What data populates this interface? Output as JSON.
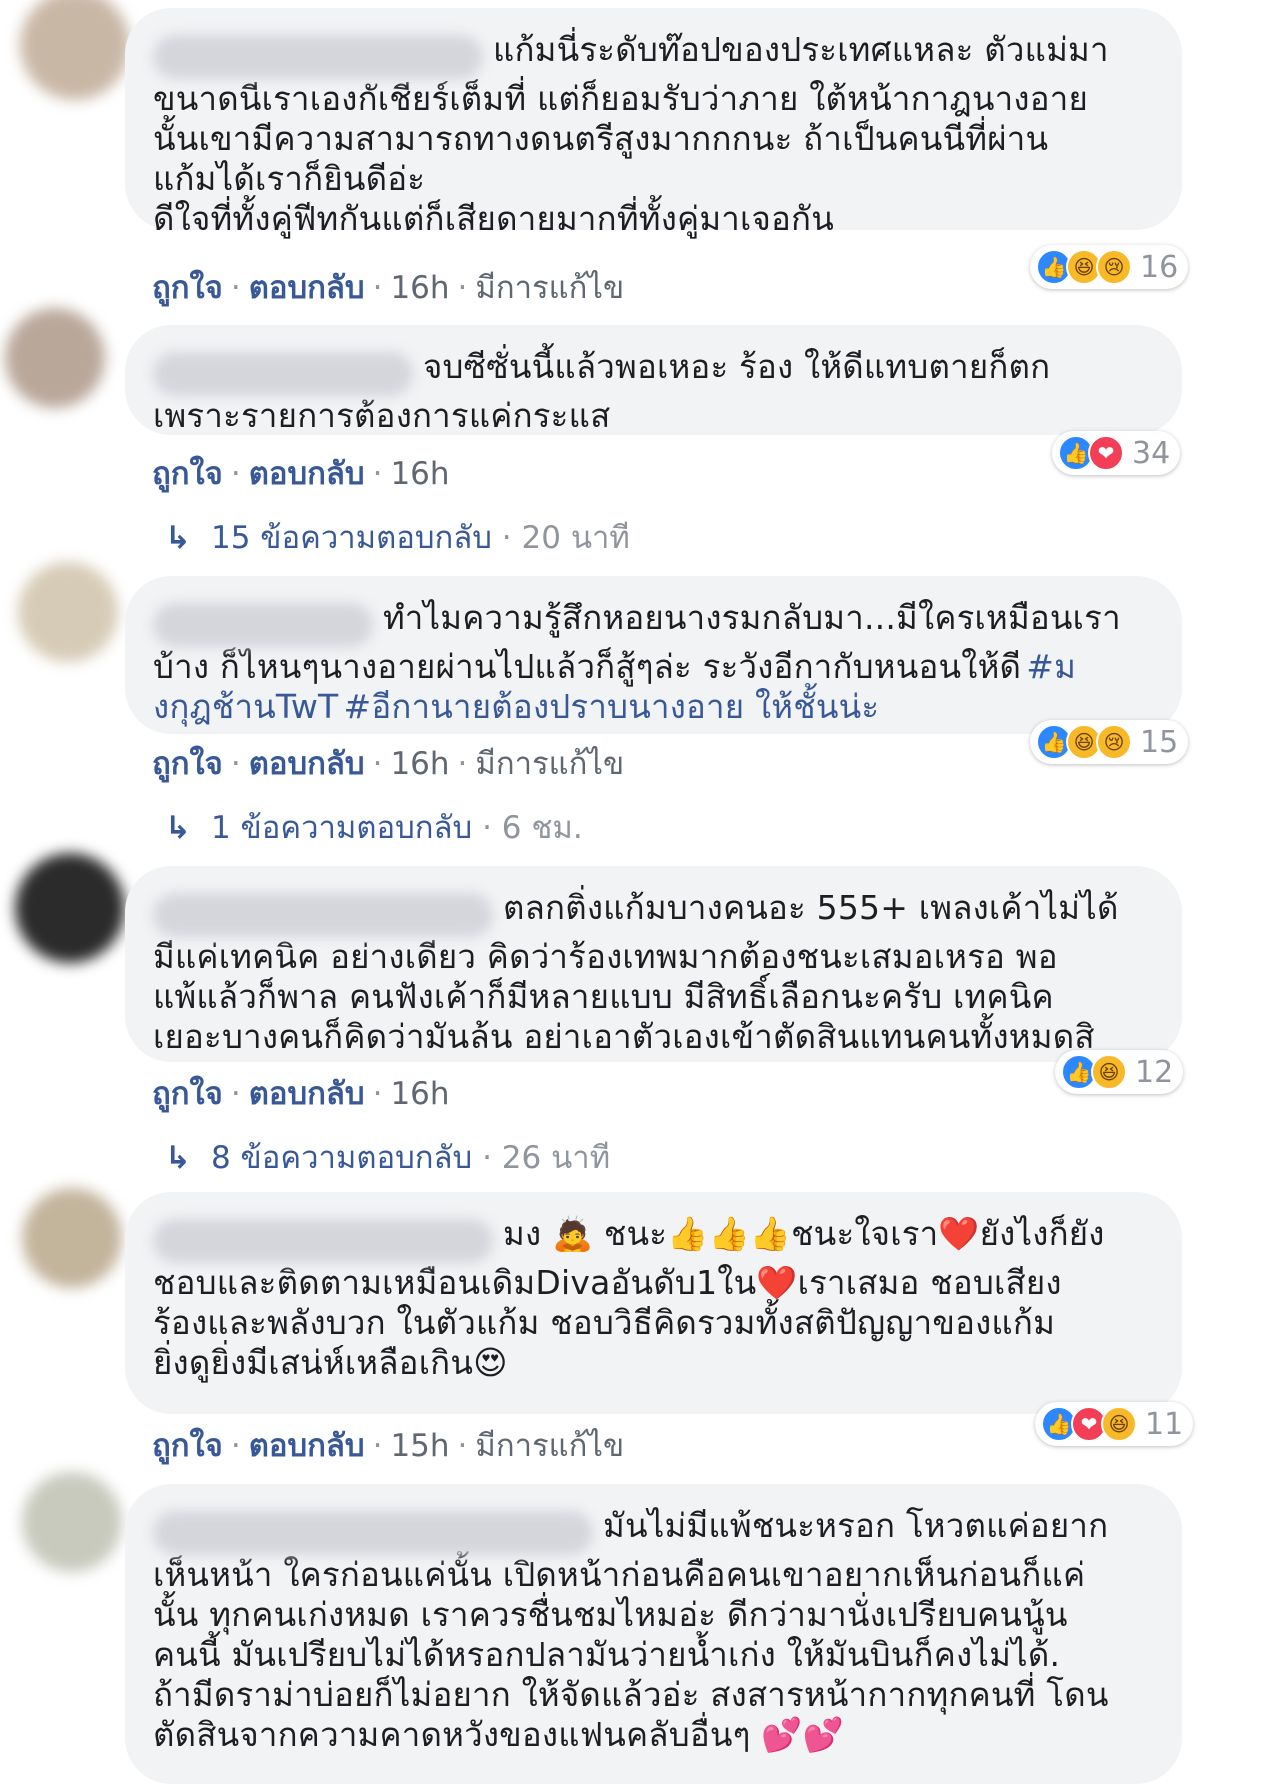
{
  "actions": {
    "like": "ถูกใจ",
    "reply": "ตอบกลับ"
  },
  "comments": [
    {
      "first_line": "แก้มนี่ระดับท๊อปของประเทศแหละ ตัวแม่มา",
      "rest": "ขนาดนีเราเองกัเชียร์เต็มที่ แต่ก็ยอมรับว่าภาย ใต้หน้ากาฎนางอาย\nนั้นเขามีความสามารถทางดนตรีสูงมากกกนะ ถ้าเป็นคนนีที่ผ่าน\nแก้มได้เราก็ยินดีอ่ะ\nดีใจที่ทั้งคู่ฟีทกันแต่ก็เสียดายมากที่ทั้งคู่มาเจอกัน",
      "time": "16h",
      "edited": "มีการแก้ไข",
      "reactions": {
        "icons": [
          "like",
          "haha",
          "sad"
        ],
        "count": "16"
      }
    },
    {
      "first_line": "จบซีซั่นนี้แล้วพอเหอะ ร้อง ให้ดีแทบตายก็ตก",
      "rest": "เพราะรายการต้องการแค่กระแส",
      "time": "16h",
      "reactions": {
        "icons": [
          "like",
          "love"
        ],
        "count": "34"
      },
      "replies": {
        "label": "15 ข้อความตอบกลับ",
        "time": "20 นาที"
      }
    },
    {
      "first_line": "ทำไมความรู้สึกหอยนางรมกลับมา...มีใครเหมือนเรา",
      "rest": "บ้าง ก็ไหนๆนางอายผ่านไปแล้วก็สู้ๆล่ะ ระวังอีกากับหนอนให้ดี",
      "hashtag1": "#ม",
      "hashtag2": "งกุฎช้านTwT",
      "hashtag3": "#อีกานายต้องปราบนางอาย ให้ชั้นน่ะ",
      "time": "16h",
      "edited": "มีการแก้ไข",
      "reactions": {
        "icons": [
          "like",
          "haha",
          "sad"
        ],
        "count": "15"
      },
      "replies": {
        "label": "1 ข้อความตอบกลับ",
        "time": "6 ชม."
      }
    },
    {
      "first_line": "ตลกติ่งแก้มบางคนอะ 555+ เพลงเค้าไม่ได้",
      "rest": "มีแค่เทคนิค อย่างเดียว คิดว่าร้องเทพมากต้องชนะเสมอเหรอ พอ\nแพ้แล้วก็พาล คนฟังเค้าก็มีหลายแบบ มีสิทธิ์เลือกนะครับ เทคนิค\nเยอะบางคนก็คิดว่ามันล้น อย่าเอาตัวเองเข้าตัดสินแทนคนทั้งหมดสิ",
      "time": "16h",
      "reactions": {
        "icons": [
          "like",
          "haha"
        ],
        "count": "12"
      },
      "replies": {
        "label": "8 ข้อความตอบกลับ",
        "time": "26 นาที"
      }
    },
    {
      "first_line": "มง 🙇 ชนะ👍👍👍ชนะใจเรา❤️ยังไงก็ยัง",
      "rest": "ชอบและติดตามเหมือนเดิมDivaอันดับ1ใน❤️เราเสมอ ชอบเสียง\nร้องและพลังบวก ในตัวแก้ม ชอบวิธีคิดรวมทั้งสติปัญญาของแก้ม\nยิ่งดูยิ่งมีเสน่ห์เหลือเกิน😍",
      "time": "15h",
      "edited": "มีการแก้ไข",
      "reactions": {
        "icons": [
          "like",
          "love",
          "haha"
        ],
        "count": "11"
      }
    },
    {
      "first_line": "มันไม่มีแพ้ชนะหรอก โหวตแค่อยาก",
      "rest": "เห็นหน้า ใครก่อนแค่นั้น เปิดหน้าก่อนคือคนเขาอยากเห็นก่อนก็แค่\nนั้น ทุกคนเก่งหมด เราควรชื่นชมไหมอ่ะ ดีกว่ามานั่งเปรียบคนนู้น\nคนนี้ มันเปรียบไม่ได้หรอกปลามันว่ายน้ำเก่ง ให้มันบินก็คงไม่ได้.\nถ้ามีดราม่าบ่อยก็ไม่อยาก ให้จัดแล้วอ่ะ สงสารหน้ากากทุกคนที่ โดน\nตัดสินจากความคาดหวังของแฟนคลับอื่นๆ 💕💕"
    }
  ],
  "icon_glyphs": {
    "like": "👍",
    "love": "❤",
    "haha": "😆",
    "sad": "😢",
    "wow": "😮"
  },
  "colors": {
    "link": "#385898",
    "bubble": "#f2f3f5",
    "meta": "#606770"
  }
}
